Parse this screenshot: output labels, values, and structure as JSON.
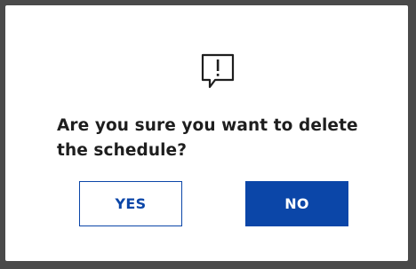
{
  "dialog": {
    "icon": "speech-bubble-exclamation-icon",
    "message": "Are you sure you want to delete the schedule?",
    "yes_label": "YES",
    "no_label": "NO"
  },
  "colors": {
    "primary": "#0b46a8",
    "text": "#1e1e1e",
    "frame": "#4a4a4a",
    "background": "#ffffff"
  }
}
